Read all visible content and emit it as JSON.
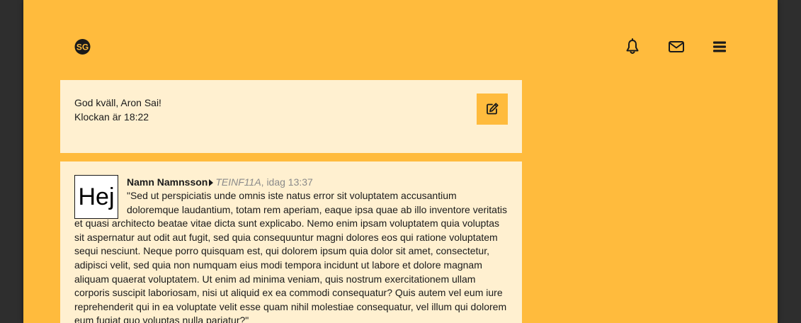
{
  "header": {
    "logo_text": "SG",
    "icons": [
      "bell-icon",
      "envelope-icon",
      "menu-icon"
    ]
  },
  "greeting": {
    "line1": "God kväll, Aron Sai!",
    "line2": "Klockan är 18:22"
  },
  "post": {
    "avatar_text": "Hej",
    "author": "Namn Namnsson",
    "group": "TEINF11A",
    "time": ", idag 13:37",
    "content": "\"Sed ut perspiciatis unde omnis iste natus error sit voluptatem accusantium doloremque laudantium, totam rem aperiam, eaque ipsa quae ab illo inventore veritatis et quasi architecto beatae vitae dicta sunt explicabo. Nemo enim ipsam voluptatem quia voluptas sit aspernatur aut odit aut fugit, sed quia consequuntur magni dolores eos qui ratione voluptatem sequi nesciunt. Neque porro quisquam est, qui dolorem ipsum quia dolor sit amet, consectetur, adipisci velit, sed quia non numquam eius modi tempora incidunt ut labore et dolore magnam aliquam quaerat voluptatem. Ut enim ad minima veniam, quis nostrum exercitationem ullam corporis suscipit laboriosam, nisi ut aliquid ex ea commodi consequatur? Quis autem vel eum iure reprehenderit qui in ea voluptate velit esse quam nihil molestiae consequatur, vel illum qui dolorem eum fugiat quo voluptas nulla pariatur?\""
  },
  "colors": {
    "background": "#2e2e2e",
    "accent": "#ffbb3d",
    "card": "#fff0d0",
    "text": "#1a1a1a",
    "muted": "#8a8a8a"
  }
}
